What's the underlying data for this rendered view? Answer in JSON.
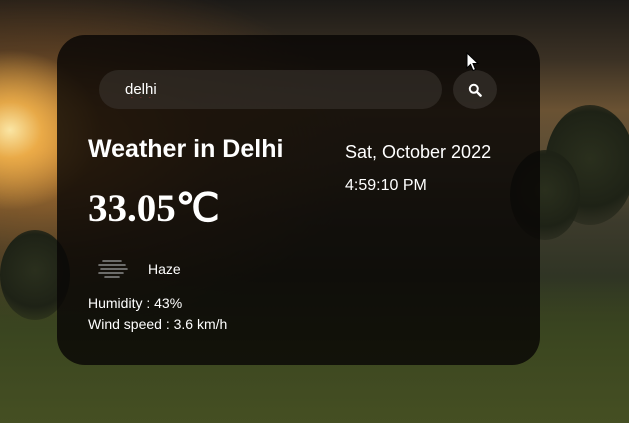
{
  "search": {
    "value": "delhi",
    "button_icon": "search-icon"
  },
  "weather": {
    "city_heading": "Weather in Delhi",
    "date": "Sat, October 2022",
    "time": "4:59:10 PM",
    "temperature": "33.05℃",
    "condition_icon": "haze-icon",
    "condition": "Haze",
    "humidity": "Humidity : 43%",
    "wind_speed": "Wind speed : 3.6 km/h"
  },
  "colors": {
    "card_background": "#080605",
    "text": "#ffffff",
    "input_background": "#3c3732"
  }
}
